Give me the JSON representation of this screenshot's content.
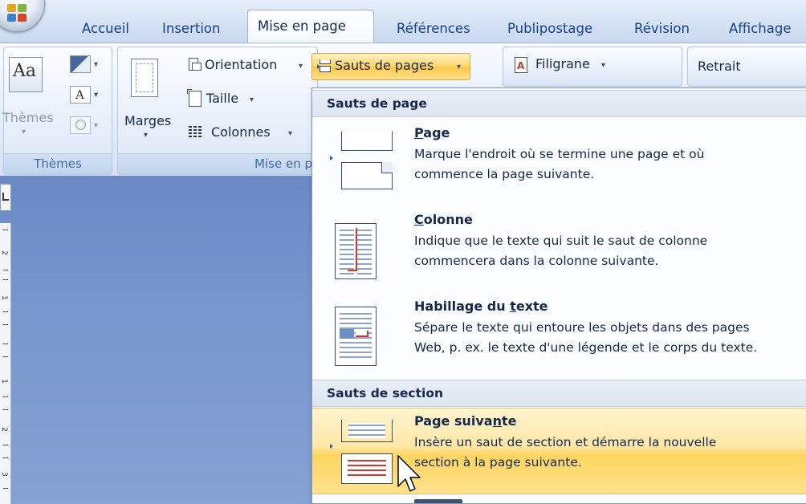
{
  "tabs": [
    {
      "label": "Accueil"
    },
    {
      "label": "Insertion"
    },
    {
      "label": "Mise en page"
    },
    {
      "label": "Références"
    },
    {
      "label": "Publipostage"
    },
    {
      "label": "Révision"
    },
    {
      "label": "Affichage"
    }
  ],
  "active_tab": "Mise en page",
  "ribbon": {
    "themes_group": {
      "themes_button": "Thèmes",
      "icon_text": "Aa",
      "fonts_icon_text": "A",
      "label": "Thèmes"
    },
    "page_setup_group": {
      "margins": "Marges",
      "orientation": "Orientation",
      "size": "Taille",
      "columns": "Colonnes",
      "page_breaks": "Sauts de pages",
      "label": "Mise en p"
    },
    "background_group": {
      "watermark": "Filigrane"
    },
    "paragraph_group": {
      "indent": "Retrait"
    }
  },
  "dropdown": {
    "page_breaks_header": "Sauts de page",
    "section_breaks_header": "Sauts de section",
    "items": [
      {
        "title_pre": "",
        "title_key": "P",
        "title_post": "age",
        "desc": [
          "Marque l'endroit où se termine une page et où",
          "commence la page suivante."
        ],
        "icon": "page-break-icon"
      },
      {
        "title_pre": "",
        "title_key": "C",
        "title_post": "olonne",
        "desc": [
          "Indique que le texte qui suit le saut de colonne",
          "commencera dans la colonne suivante."
        ],
        "icon": "column-break-icon"
      },
      {
        "title_pre": "Habillage du ",
        "title_key": "t",
        "title_post": "exte",
        "desc": [
          "Sépare le texte qui entoure les objets dans des pages",
          "Web, p. ex. le texte d'une légende et le corps du texte."
        ],
        "icon": "text-wrapping-icon"
      },
      {
        "title_pre": "Page suiva",
        "title_key": "n",
        "title_post": "te",
        "desc": [
          "Insère un saut de section et démarre la nouvelle",
          "section à la page suivante."
        ],
        "icon": "next-page-icon",
        "highlighted": true
      }
    ]
  },
  "ruler_numbers": [
    "2",
    "1",
    "1",
    "2",
    "3"
  ],
  "colors": {
    "accent": "#15428b",
    "highlight": "#ffd55f",
    "document_bg": "#7896cd"
  }
}
